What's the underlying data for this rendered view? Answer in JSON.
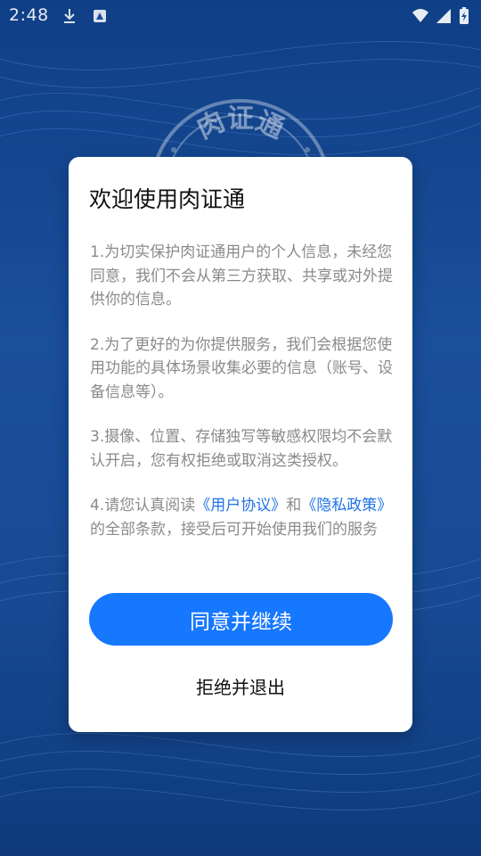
{
  "status_bar": {
    "time": "2:48",
    "icons": [
      "download-icon",
      "app-notification-icon",
      "wifi-icon",
      "signal-icon",
      "battery-charging-icon"
    ]
  },
  "background": {
    "logo_text": "肉证通",
    "color": "#174a93"
  },
  "dialog": {
    "title": "欢迎使用肉证通",
    "terms": [
      {
        "text": "1.为切实保护肉证通用户的个人信息，未经您同意，我们不会从第三方获取、共享或对外提供你的信息。"
      },
      {
        "text": "2.为了更好的为你提供服务，我们会根据您使用功能的具体场景收集必要的信息（账号、设备信息等）。"
      },
      {
        "text": "3.摄像、位置、存储独写等敏感权限均不会默认开启，您有权拒绝或取消这类授权。"
      },
      {
        "prefix": "4.请您认真阅读",
        "user_agreement_link": "《用户协议》",
        "connector": "和",
        "privacy_policy_link": "《隐私政策》",
        "suffix": "的全部条款，接受后可开始使用我们的服务"
      }
    ],
    "agree_button_label": "同意并继续",
    "reject_button_label": "拒绝并退出"
  },
  "colors": {
    "primary": "#1677ff",
    "link": "#1f73e6",
    "body_text": "#8a8a8a",
    "title_text": "#111111"
  }
}
